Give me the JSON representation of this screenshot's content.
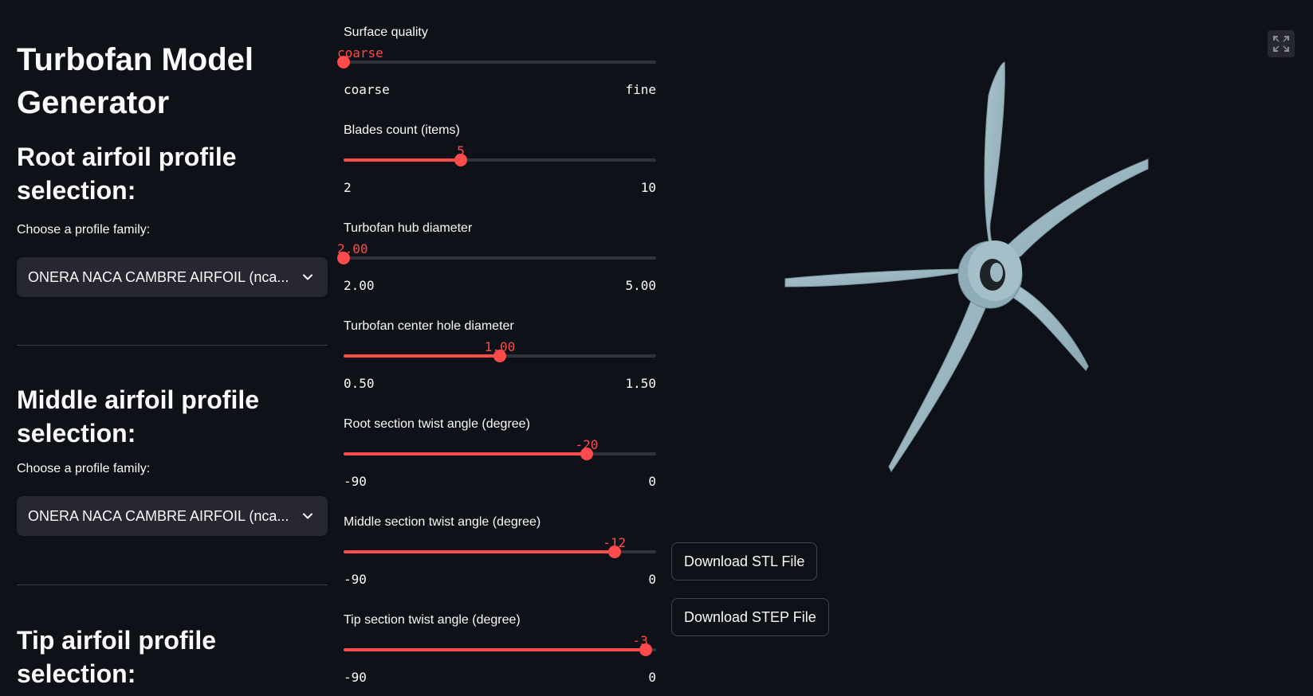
{
  "app": {
    "title": "Turbofan Model Generator"
  },
  "sections": [
    {
      "title": "Root airfoil profile selection:",
      "select_label": "Choose a profile family:",
      "select_value": "ONERA NACA CAMBRE AIRFOIL (nca..."
    },
    {
      "title": "Middle airfoil profile selection:",
      "select_label": "Choose a profile family:",
      "select_value": "ONERA NACA CAMBRE AIRFOIL (nca..."
    },
    {
      "title": "Tip airfoil profile selection:"
    }
  ],
  "sliders": [
    {
      "label": "Surface quality",
      "value_text": "coarse",
      "min_text": "coarse",
      "max_text": "fine",
      "fraction": 0.0
    },
    {
      "label": "Blades count (items)",
      "value_text": "5",
      "min_text": "2",
      "max_text": "10",
      "fraction": 0.375
    },
    {
      "label": "Turbofan hub diameter",
      "value_text": "2.00",
      "min_text": "2.00",
      "max_text": "5.00",
      "fraction": 0.0
    },
    {
      "label": "Turbofan center hole diameter",
      "value_text": "1.00",
      "min_text": "0.50",
      "max_text": "1.50",
      "fraction": 0.5
    },
    {
      "label": "Root section twist angle (degree)",
      "value_text": "-20",
      "min_text": "-90",
      "max_text": "0",
      "fraction": 0.7778
    },
    {
      "label": "Middle section twist angle (degree)",
      "value_text": "-12",
      "min_text": "-90",
      "max_text": "0",
      "fraction": 0.8667
    },
    {
      "label": "Tip section twist angle (degree)",
      "value_text": "-3",
      "min_text": "-90",
      "max_text": "0",
      "fraction": 0.9667
    }
  ],
  "buttons": {
    "download_stl": "Download STL File",
    "download_step": "Download STEP File"
  },
  "colors": {
    "background": "#0e1117",
    "accent": "#ff4b4b",
    "track": "#31333b",
    "select_bg": "#262730",
    "model": "#9db8c2"
  },
  "icons": {
    "select_chevron": "chevron-down-icon",
    "fullscreen": "fullscreen-icon"
  }
}
